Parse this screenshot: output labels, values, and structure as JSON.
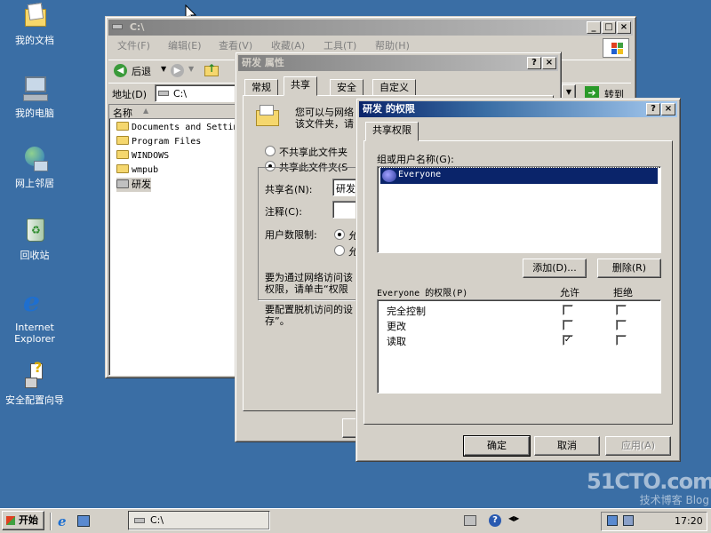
{
  "desktop": {
    "icons": [
      {
        "label": "我的文档",
        "icon": "my-documents-icon"
      },
      {
        "label": "我的电脑",
        "icon": "my-computer-icon"
      },
      {
        "label": "网上邻居",
        "icon": "network-places-icon"
      },
      {
        "label": "回收站",
        "icon": "recycle-bin-icon"
      },
      {
        "label_line1": "Internet",
        "label_line2": "Explorer",
        "icon": "internet-explorer-icon"
      },
      {
        "label": "安全配置向导",
        "icon": "security-wizard-icon"
      }
    ],
    "watermark": {
      "line1": "51CTO.com",
      "line2": "技术博客 Blog"
    }
  },
  "explorer": {
    "title": "C:\\",
    "menus": [
      "文件(F)",
      "编辑(E)",
      "查看(V)",
      "收藏(A)",
      "工具(T)",
      "帮助(H)"
    ],
    "back_label": "后退",
    "address_label": "地址(D)",
    "address_value": "C:\\",
    "go_label": "转到",
    "column_name": "名称",
    "items": [
      "Documents and Settin",
      "Program Files",
      "WINDOWS",
      "wmpub",
      "研发"
    ]
  },
  "properties": {
    "title": "研发 属性",
    "tabs": [
      "常规",
      "共享",
      "安全",
      "自定义"
    ],
    "desc_line1": "您可以与网络",
    "desc_line2": "该文件夹，请",
    "radio_not_share": "不共享此文件夹",
    "radio_share": "共享此文件夹(S",
    "share_name_label": "共享名(N):",
    "share_name_value": "研发",
    "comment_label": "注释(C):",
    "user_limit_label": "用户数限制:",
    "limit_opt1": "允",
    "limit_opt2": "允",
    "perm_text_line1": "要为通过网络访问该",
    "perm_text_line2": "权限，请单击“权限",
    "offline_text_line1": "要配置脱机访问的设",
    "offline_text_line2": "存”。"
  },
  "permissions": {
    "title": "研发 的权限",
    "tab": "共享权限",
    "group_label": "组或用户名称(G):",
    "users": [
      "Everyone"
    ],
    "add_button": "添加(D)...",
    "remove_button": "删除(R)",
    "perm_for_label": "Everyone 的权限(P)",
    "col_allow": "允许",
    "col_deny": "拒绝",
    "rows": [
      {
        "name": "完全控制",
        "allow": false,
        "deny": false
      },
      {
        "name": "更改",
        "allow": false,
        "deny": false
      },
      {
        "name": "读取",
        "allow": true,
        "deny": false
      }
    ],
    "ok_button": "确定",
    "cancel_button": "取消",
    "apply_button": "应用(A)"
  },
  "taskbar": {
    "start_label": "开始",
    "task_label": "C:\\",
    "clock": "17:20"
  }
}
